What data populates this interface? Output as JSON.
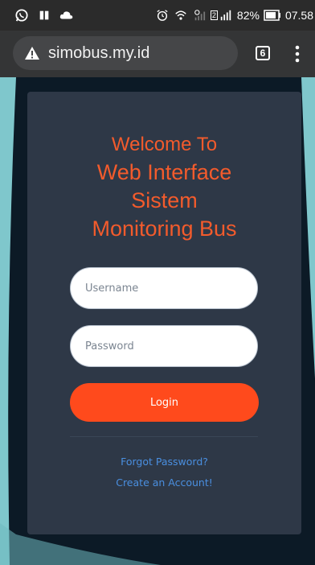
{
  "status_bar": {
    "battery": "82%",
    "time": "07.58",
    "sim_badge": "2",
    "left_icons": [
      "whatsapp-icon",
      "bookmark-icon",
      "cloud-icon"
    ],
    "right_icons": [
      "alarm-icon",
      "wifi-icon",
      "signal-icon",
      "signal-icon",
      "battery-icon"
    ]
  },
  "browser": {
    "url": "simobus.my.id",
    "tab_count": "6",
    "warning_icon": "warning-icon",
    "menu_icon": "more-vertical-icon"
  },
  "login_card": {
    "title_line1": "Welcome To",
    "title_line2": "Web Interface",
    "title_line3": "Sistem",
    "title_line4": "Monitoring Bus",
    "username_placeholder": "Username",
    "password_placeholder": "Password",
    "login_label": "Login",
    "forgot_password_link": "Forgot Password?",
    "create_account_link": "Create an Account!"
  },
  "colors": {
    "accent": "#f35b2c",
    "button": "#ff4a1c",
    "card_bg": "#2e3847",
    "link": "#4a8fe0",
    "page_bg": "#0c1a26",
    "wave": "#7fc7cc"
  }
}
